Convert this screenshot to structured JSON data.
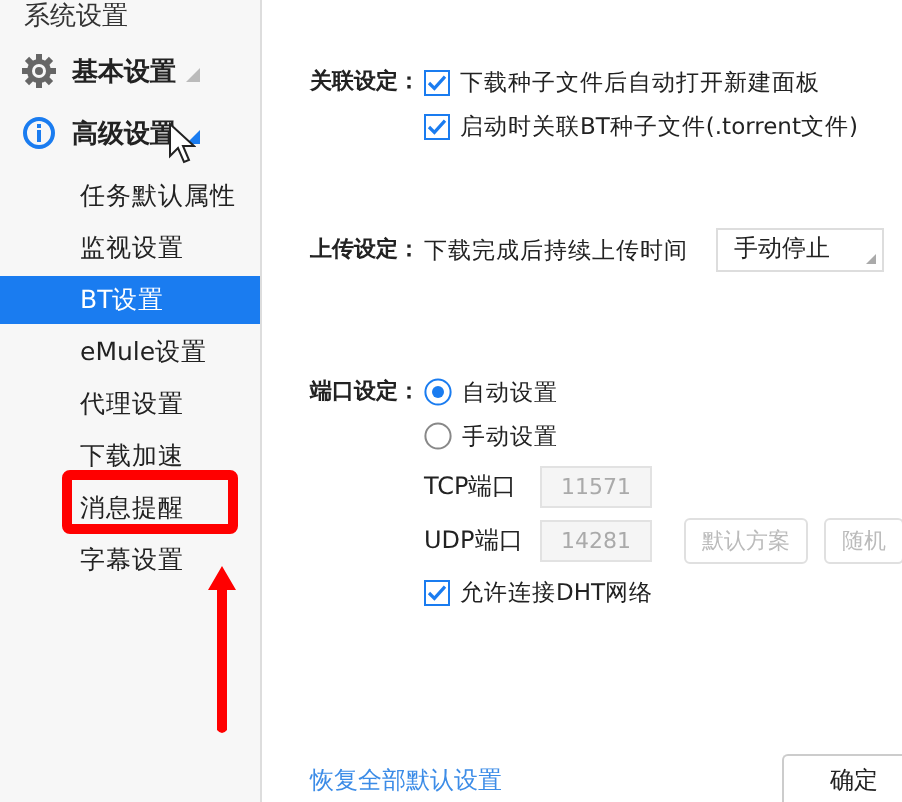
{
  "sidebar": {
    "title": "系统设置",
    "groups": [
      {
        "label": "基本设置",
        "kind": "gear",
        "expanded": false
      },
      {
        "label": "高级设置",
        "kind": "info",
        "expanded": true,
        "children": [
          {
            "label": "任务默认属性",
            "selected": false
          },
          {
            "label": "监视设置",
            "selected": false
          },
          {
            "label": "BT设置",
            "selected": true
          },
          {
            "label": "eMule设置",
            "selected": false
          },
          {
            "label": "代理设置",
            "selected": false
          },
          {
            "label": "下载加速",
            "selected": false
          },
          {
            "label": "消息提醒",
            "selected": false
          },
          {
            "label": "字幕设置",
            "selected": false
          }
        ]
      }
    ]
  },
  "sections": [
    {
      "kind": "checks",
      "label": "关联设定：",
      "items": [
        {
          "label": "下载种子文件后自动打开新建面板",
          "checked": true
        },
        {
          "label": "启动时关联BT种子文件(.torrent文件)",
          "checked": true
        }
      ]
    },
    {
      "kind": "upload",
      "label": "上传设定：",
      "text": "下载完成后持续上传时间",
      "select": "手动停止"
    },
    {
      "kind": "ports",
      "label": "端口设定：",
      "radios": [
        {
          "label": "自动设置",
          "selected": true
        },
        {
          "label": "手动设置",
          "selected": false
        }
      ],
      "ports": [
        {
          "label": "TCP端口",
          "value": "11571",
          "disabled": true
        },
        {
          "label": "UDP端口",
          "value": "14281",
          "disabled": true
        }
      ],
      "buttons": [
        {
          "label": "默认方案",
          "disabled": true
        },
        {
          "label": "随机",
          "disabled": true
        }
      ],
      "dht": {
        "label": "允许连接DHT网络",
        "checked": true
      }
    }
  ],
  "footer": {
    "restore_link": "恢复全部默认设置",
    "ok_button": "确定"
  }
}
